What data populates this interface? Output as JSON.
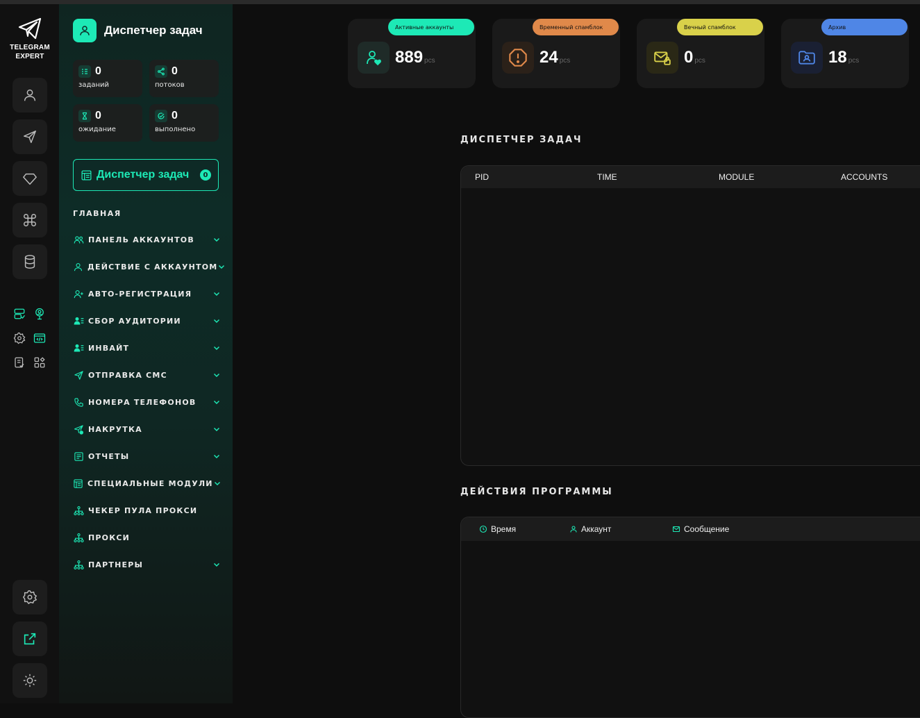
{
  "logo": {
    "line1": "TELEGRAM",
    "line2": "EXPERT"
  },
  "rail": {
    "buttons": [
      "user-icon",
      "send-icon",
      "diamond-icon",
      "command-icon",
      "database-icon"
    ],
    "mini_icons": [
      "server-check-icon",
      "location-user-icon",
      "settings-gear-icon",
      "code-window-icon",
      "checklist-icon",
      "widgets-icon"
    ],
    "bottom_buttons": [
      "settings-icon",
      "external-link-icon",
      "theme-sun-icon"
    ]
  },
  "panel": {
    "title": "Диспетчер задач",
    "stats": [
      {
        "value": "0",
        "label": "заданий",
        "icon": "task-list-icon"
      },
      {
        "value": "0",
        "label": "потоков",
        "icon": "share-icon"
      },
      {
        "value": "0",
        "label": "ожидание",
        "icon": "hourglass-icon"
      },
      {
        "value": "0",
        "label": "выполнено",
        "icon": "check-circle-icon"
      }
    ],
    "task_manager_button": {
      "label": "Диспетчер задач",
      "badge": "0"
    },
    "section_title": "ГЛАВНАЯ",
    "menu": [
      {
        "label": "ПАНЕЛЬ АККАУНТОВ",
        "icon": "users-icon",
        "expandable": true
      },
      {
        "label": "ДЕЙСТВИЕ С АККАУНТОМ",
        "icon": "user-icon",
        "expandable": true
      },
      {
        "label": "АВТО-РЕГИСТРАЦИЯ",
        "icon": "user-plus-icon",
        "expandable": true
      },
      {
        "label": "СБОР АУДИТОРИИ",
        "icon": "user-list-icon",
        "expandable": true
      },
      {
        "label": "ИНВАЙТ",
        "icon": "user-list-icon",
        "expandable": true
      },
      {
        "label": "ОТПРАВКА СМС",
        "icon": "send-icon",
        "expandable": true
      },
      {
        "label": "НОМЕРА ТЕЛЕФОНОВ",
        "icon": "phone-icon",
        "expandable": true
      },
      {
        "label": "НАКРУТКА",
        "icon": "send-plus-icon",
        "expandable": true
      },
      {
        "label": "ОТЧЕТЫ",
        "icon": "report-icon",
        "expandable": true
      },
      {
        "label": "СПЕЦИАЛЬНЫЕ МОДУЛИ",
        "icon": "module-icon",
        "expandable": true
      },
      {
        "label": "ЧЕКЕР ПУЛА ПРОКСИ",
        "icon": "network-icon",
        "expandable": false
      },
      {
        "label": "ПРОКСИ",
        "icon": "network-icon",
        "expandable": false
      },
      {
        "label": "ПАРТНЕРЫ",
        "icon": "network-icon",
        "expandable": true
      }
    ]
  },
  "cards": [
    {
      "pill": "Активные аккаунты",
      "value": "889",
      "unit": "pcs",
      "color": "#1de9b6",
      "icon": "user-heart-icon"
    },
    {
      "pill": "Временный спамблок",
      "value": "24",
      "unit": "pcs",
      "color": "#e0894a",
      "icon": "warning-octagon-icon"
    },
    {
      "pill": "Вечный спамблок",
      "value": "0",
      "unit": "pcs",
      "color": "#d9d14a",
      "icon": "mail-lock-icon"
    },
    {
      "pill": "Архив",
      "value": "18",
      "unit": "pcs",
      "color": "#4f86e6",
      "icon": "folder-user-icon"
    }
  ],
  "task_manager": {
    "title": "ДИСПЕТЧЕР ЗАДАЧ",
    "columns": [
      "PID",
      "TIME",
      "MODULE",
      "ACCOUNTS"
    ]
  },
  "program_actions": {
    "title": "ДЕЙСТВИЯ ПРОГРАММЫ",
    "columns": [
      {
        "label": "Время",
        "icon": "clock-icon"
      },
      {
        "label": "Аккаунт",
        "icon": "user-icon"
      },
      {
        "label": "Сообщение",
        "icon": "mail-icon"
      }
    ]
  },
  "colors": {
    "accent": "#1de9b6",
    "bg": "#0e0e0e"
  }
}
